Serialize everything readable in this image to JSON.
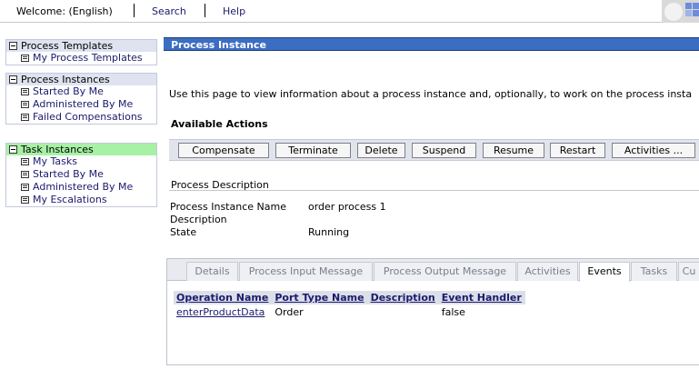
{
  "topbar": {
    "welcome": "Welcome: (English)",
    "search": "Search",
    "help": "Help"
  },
  "nav": {
    "process_templates": {
      "header": "Process Templates",
      "items": [
        "My Process Templates"
      ]
    },
    "process_instances": {
      "header": "Process Instances",
      "items": [
        "Started By Me",
        "Administered By Me",
        "Failed Compensations"
      ]
    },
    "task_instances": {
      "header": "Task Instances",
      "items": [
        "My Tasks",
        "Started By Me",
        "Administered By Me",
        "My Escalations"
      ]
    }
  },
  "main": {
    "title": "Process Instance",
    "intro": "Use this page to view information about a process instance and, optionally, to work on the process insta",
    "actions_heading": "Available Actions",
    "actions": [
      "Compensate",
      "Terminate",
      "Delete",
      "Suspend",
      "Resume",
      "Restart",
      "Activities ..."
    ],
    "description_heading": "Process Description",
    "fields": {
      "name_label": "Process Instance Name",
      "name_value": "order process 1",
      "description_label": "Description",
      "description_value": "",
      "state_label": "State",
      "state_value": "Running"
    },
    "tabs": [
      "Details",
      "Process Input Message",
      "Process Output Message",
      "Activities",
      "Events",
      "Tasks",
      "Cu"
    ],
    "active_tab": "Events",
    "events_table": {
      "columns": [
        "Operation Name",
        "Port Type Name",
        "Description",
        "Event Handler"
      ],
      "rows": [
        [
          "enterProductData",
          "Order",
          "",
          "false"
        ]
      ]
    }
  },
  "colors": {
    "title_bar": "#3b6dc2",
    "task_header": "#a7f1a5",
    "nav_header": "#dfe3f0",
    "link": "#1a1a6e"
  }
}
